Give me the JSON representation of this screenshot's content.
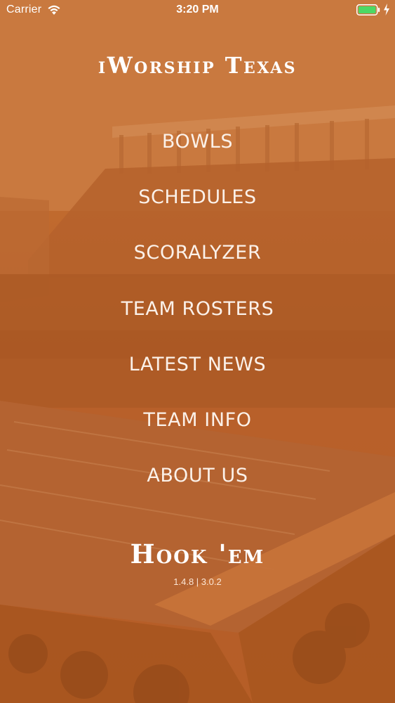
{
  "status_bar": {
    "carrier": "Carrier",
    "time": "3:20 PM",
    "wifi_icon": "wifi-icon",
    "battery_icon": "battery-icon",
    "battery_color": "#4cd964",
    "charging_icon": "charging-bolt-icon"
  },
  "header": {
    "title": "iWorship Texas"
  },
  "menu": {
    "items": [
      {
        "label": "BOWLS"
      },
      {
        "label": "SCHEDULES"
      },
      {
        "label": "SCORALYZER"
      },
      {
        "label": "TEAM ROSTERS"
      },
      {
        "label": "LATEST NEWS"
      },
      {
        "label": "TEAM INFO"
      },
      {
        "label": "ABOUT US"
      }
    ]
  },
  "footer": {
    "title": "Hook 'em",
    "version": "1.4.8 | 3.0.2"
  },
  "theme": {
    "accent": "#bf6a2e",
    "text": "#ffffff"
  }
}
